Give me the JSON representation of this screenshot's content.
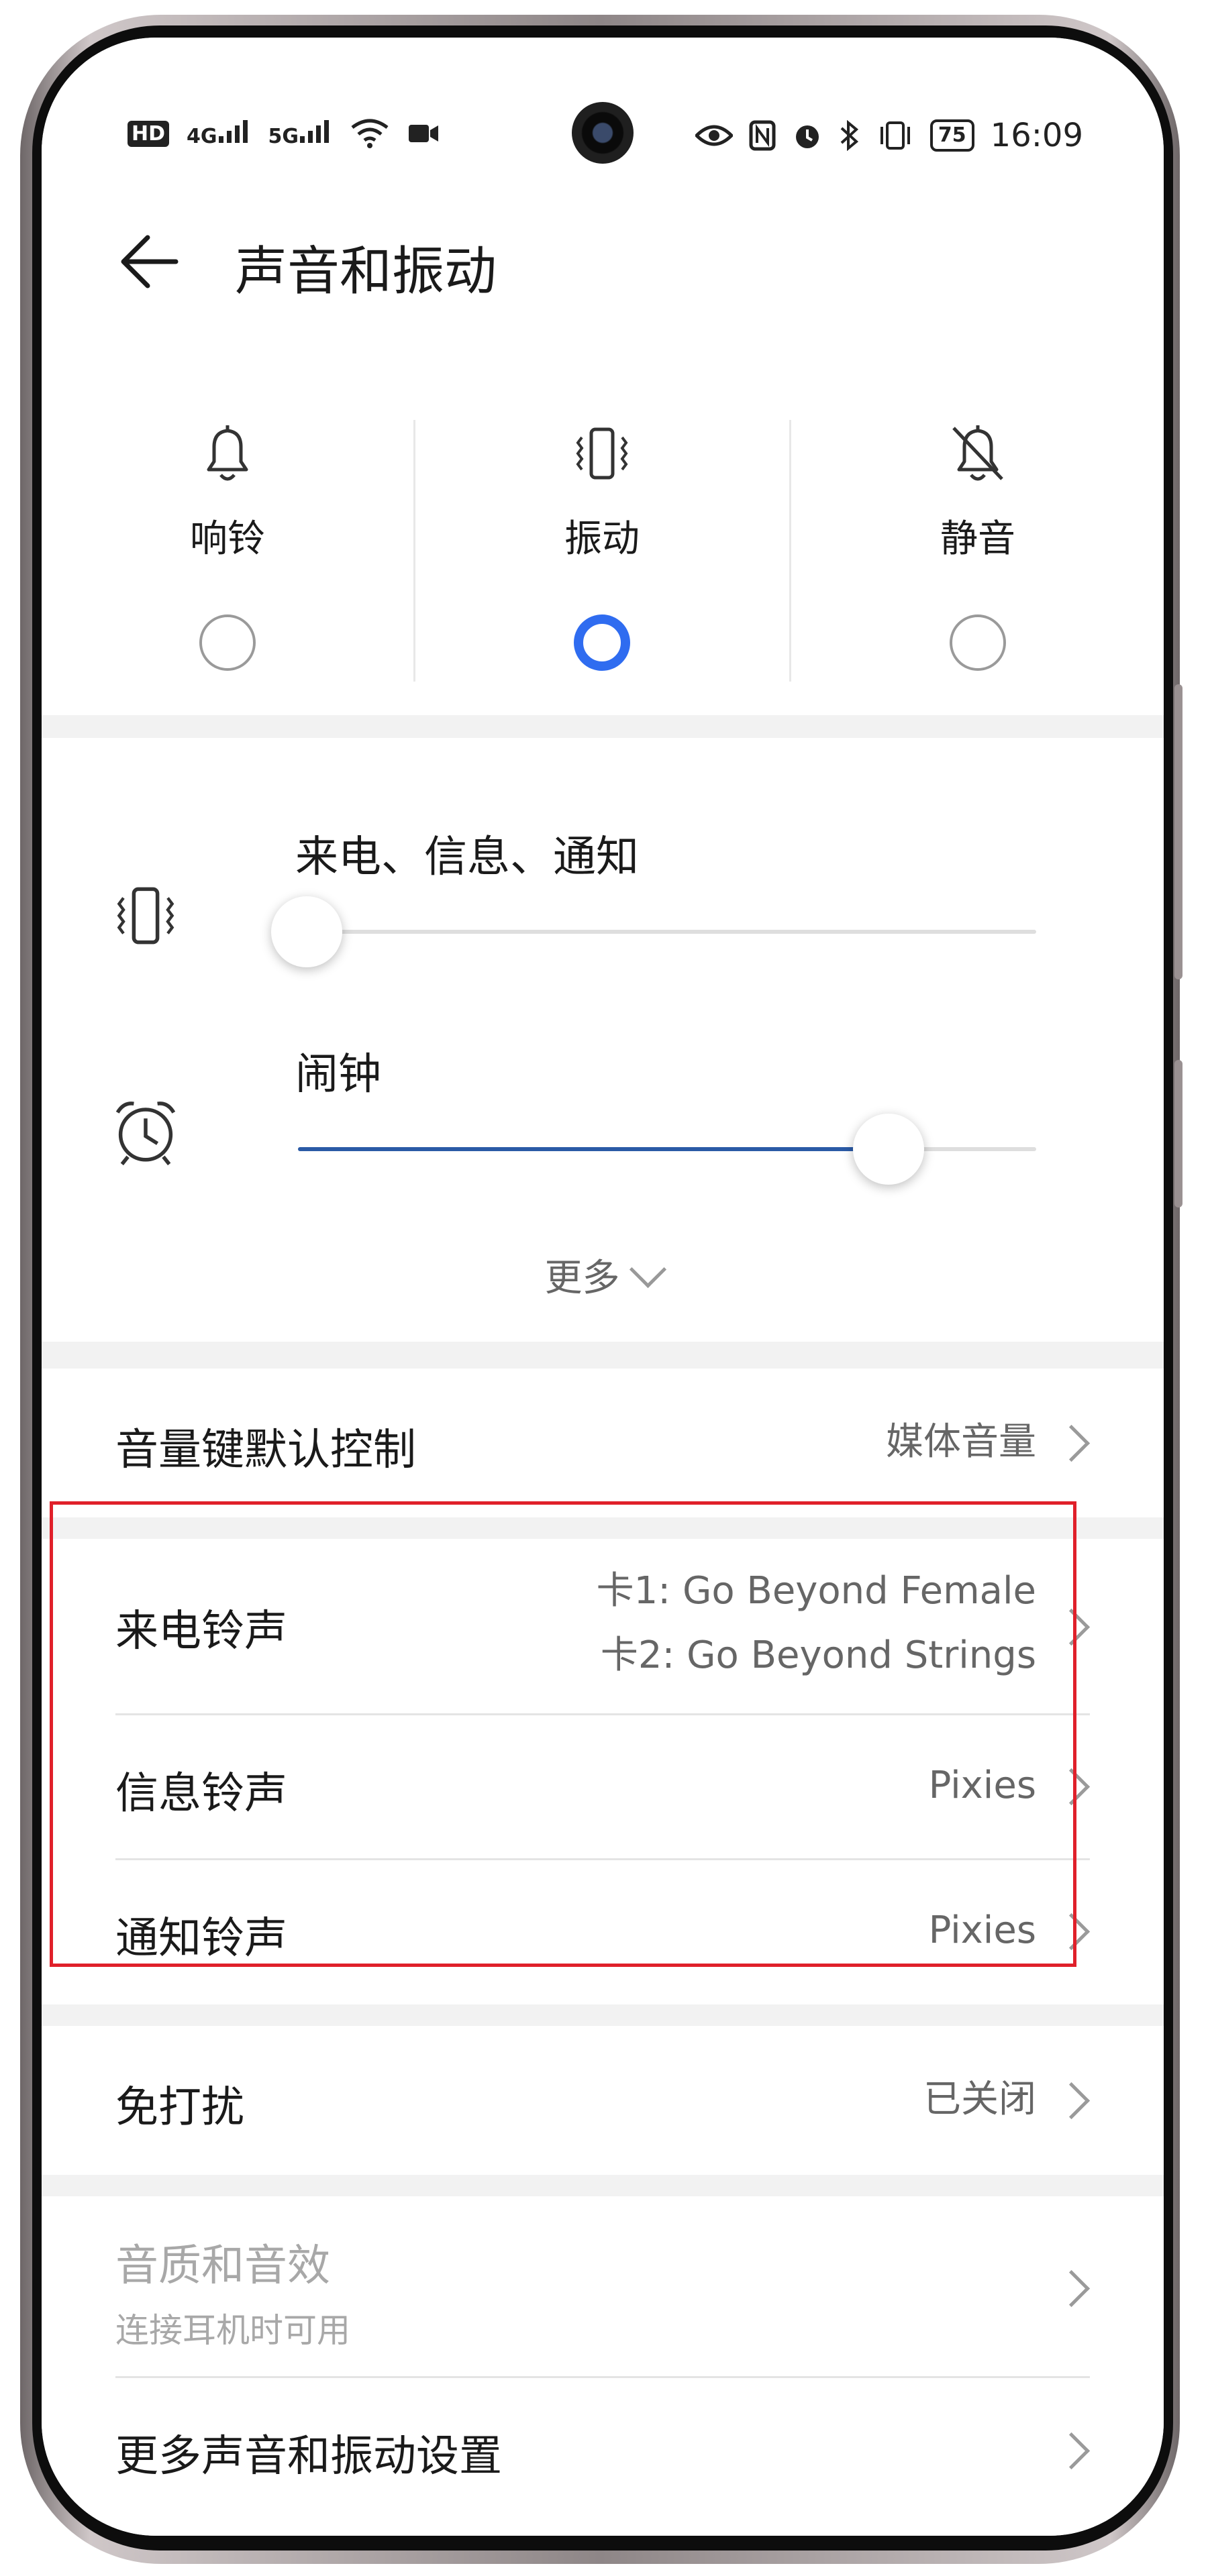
{
  "status_bar": {
    "left_icons": [
      "HD",
      "4G",
      "5G",
      "wifi-icon",
      "video-icon"
    ],
    "right_icons": [
      "eye-icon",
      "nfc-icon",
      "alarm-icon",
      "bluetooth-icon",
      "vibrate-icon"
    ],
    "battery": "75",
    "time": "16:09"
  },
  "header": {
    "title": "声音和振动"
  },
  "modes": [
    {
      "label": "响铃",
      "icon": "bell-icon",
      "selected": false
    },
    {
      "label": "振动",
      "icon": "vibrate-icon",
      "selected": true
    },
    {
      "label": "静音",
      "icon": "bell-off-icon",
      "selected": false
    }
  ],
  "volume": {
    "calls": {
      "label": "来电、信息、通知",
      "level": 0.0
    },
    "alarm": {
      "label": "闹钟",
      "level": 0.8
    },
    "more_label": "更多"
  },
  "settings": {
    "volume_key": {
      "title": "音量键默认控制",
      "value": "媒体音量"
    },
    "ringtone": {
      "title": "来电铃声",
      "value_line1": "卡1: Go Beyond Female",
      "value_line2": "卡2: Go Beyond Strings"
    },
    "message_tone": {
      "title": "信息铃声",
      "value": "Pixies"
    },
    "notification_tone": {
      "title": "通知铃声",
      "value": "Pixies"
    },
    "dnd": {
      "title": "免打扰",
      "value": "已关闭"
    },
    "sound_quality": {
      "title": "音质和音效",
      "subtitle": "连接耳机时可用"
    },
    "more_settings": {
      "title": "更多声音和振动设置"
    }
  },
  "colors": {
    "accent": "#2f6cf0",
    "highlight_box": "#e0202a",
    "slider_fill": "#2a5aa6"
  }
}
